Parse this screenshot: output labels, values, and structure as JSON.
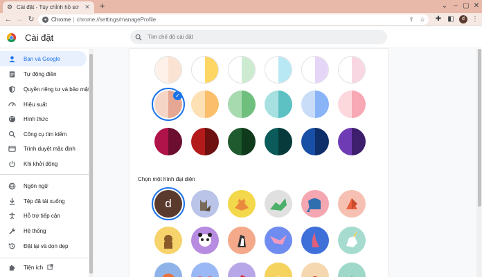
{
  "browser": {
    "tab_title": "Cài đặt - Tùy chỉnh hồ sơ",
    "site_label": "Chrome",
    "url": "chrome://settings/manageProfile",
    "profile_letter": "d"
  },
  "header": {
    "title": "Cài đặt",
    "search_placeholder": "Tìm chế độ cài đặt"
  },
  "sidebar": {
    "items": [
      {
        "label": "Bạn và Google",
        "icon": "person-icon",
        "active": true
      },
      {
        "label": "Tự động điền",
        "icon": "clipboard-icon"
      },
      {
        "label": "Quyền riêng tư và bảo mật",
        "icon": "shield-icon"
      },
      {
        "label": "Hiệu suất",
        "icon": "speed-icon"
      },
      {
        "label": "Hình thức",
        "icon": "palette-icon"
      },
      {
        "label": "Công cụ tìm kiếm",
        "icon": "search-icon"
      },
      {
        "label": "Trình duyệt mặc định",
        "icon": "browser-icon"
      },
      {
        "label": "Khi khởi động",
        "icon": "power-icon"
      },
      {
        "label": "Ngôn ngữ",
        "icon": "globe-icon"
      },
      {
        "label": "Tệp đã tải xuống",
        "icon": "download-icon"
      },
      {
        "label": "Hỗ trợ tiếp cận",
        "icon": "accessibility-icon"
      },
      {
        "label": "Hệ thống",
        "icon": "wrench-icon"
      },
      {
        "label": "Đặt lại và dọn dẹp",
        "icon": "reset-icon"
      },
      {
        "label": "Tiện ích",
        "icon": "puzzle-icon"
      }
    ]
  },
  "colors": {
    "accent": "#1a73e8",
    "swatch_rows": [
      [
        [
          "#fdf1ea",
          "#fbe3d4"
        ],
        [
          "#ffffff",
          "#fdd663"
        ],
        [
          "#ffffff",
          "#cdebd0"
        ],
        [
          "#ffffff",
          "#b9e8f5"
        ],
        [
          "#ffffff",
          "#e5d6f8"
        ],
        [
          "#ffffff",
          "#f8d7e2"
        ]
      ],
      [
        [
          "#f5d5c6",
          "#e5a793"
        ],
        [
          "#fde0b4",
          "#fbbf6b"
        ],
        [
          "#a8dab0",
          "#6fbf7e"
        ],
        [
          "#a7e0e0",
          "#5dc1c4"
        ],
        [
          "#c9dcf8",
          "#8ab4f8"
        ],
        [
          "#fcd8dd",
          "#f7a8b4"
        ]
      ],
      [
        [
          "#b0124a",
          "#6b0e30"
        ],
        [
          "#b31b1b",
          "#6e1010"
        ],
        [
          "#1e5a2e",
          "#0f3a1c"
        ],
        [
          "#0b5b5b",
          "#073b3b"
        ],
        [
          "#174ea6",
          "#0f2f6b"
        ],
        [
          "#6f3bb5",
          "#3d1f6e"
        ]
      ]
    ]
  },
  "avatars": {
    "section_label": "Chọn một hình đại diện"
  }
}
